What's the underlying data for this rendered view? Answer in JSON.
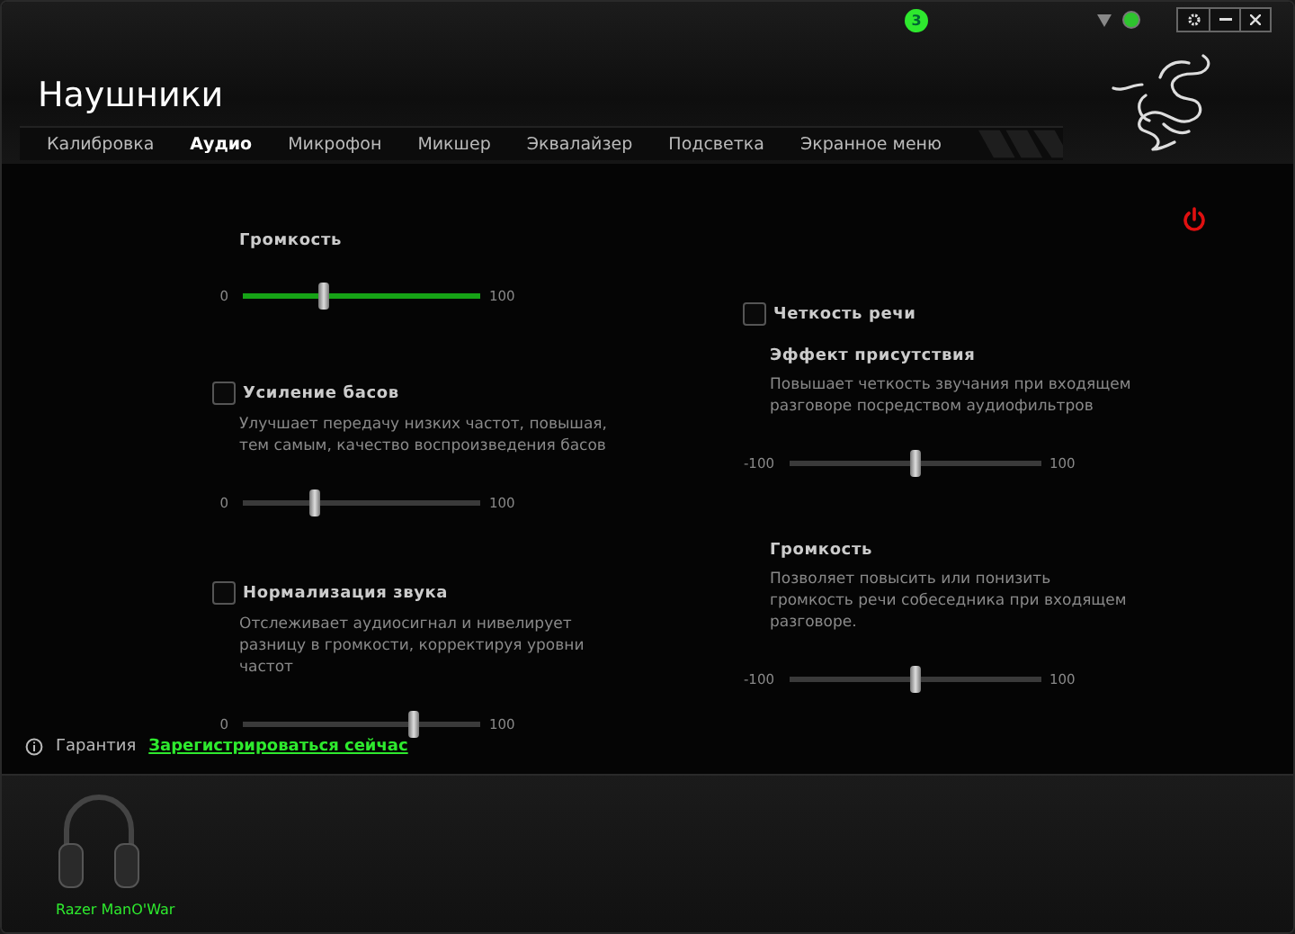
{
  "window": {
    "notification_count": "3",
    "title": "Наушники"
  },
  "tabs": [
    {
      "label": "Калибровка",
      "selected": false
    },
    {
      "label": "Аудио",
      "selected": true
    },
    {
      "label": "Микрофон",
      "selected": false
    },
    {
      "label": "Микшер",
      "selected": false
    },
    {
      "label": "Эквалайзер",
      "selected": false
    },
    {
      "label": "Подсветка",
      "selected": false
    },
    {
      "label": "Экранное меню",
      "selected": false
    }
  ],
  "left_column": [
    {
      "kind": "slider",
      "title": "Громкость",
      "slider": {
        "min": "0",
        "max": "100",
        "level": 0.34,
        "accent": true
      }
    },
    {
      "kind": "option",
      "title": "Усиление басов",
      "checked": false,
      "description": "Улучшает передачу низких частот, повышая, тем самым, качество воспроизведения басов",
      "slider": {
        "min": "0",
        "max": "100",
        "level": 0.3,
        "accent": false
      }
    },
    {
      "kind": "option",
      "title": "Нормализация звука",
      "checked": false,
      "description": "Отслеживает аудиосигнал и нивелирует разницу в громкости, корректируя уровни частот",
      "slider": {
        "min": "0",
        "max": "100",
        "level": 0.72,
        "accent": false
      }
    }
  ],
  "right_column": [
    {
      "kind": "toggle",
      "title": "Четкость речи",
      "checked": false
    },
    {
      "kind": "slider",
      "title": "Эффект присутствия",
      "description": "Повышает четкость звучания при входящем разговоре посредством аудиофильтров",
      "slider": {
        "min": "-100",
        "max": "100",
        "level": 0.5,
        "accent": false
      }
    },
    {
      "kind": "slider",
      "title": "Громкость",
      "description": "Позволяет повысить или понизить громкость речи собеседника при входящем разговоре.",
      "slider": {
        "min": "-100",
        "max": "100",
        "level": 0.5,
        "accent": false
      }
    }
  ],
  "warranty": {
    "label": "Гарантия",
    "link": "Зарегистрироваться сейчас"
  },
  "device": {
    "name": "Razer ManO'War"
  }
}
